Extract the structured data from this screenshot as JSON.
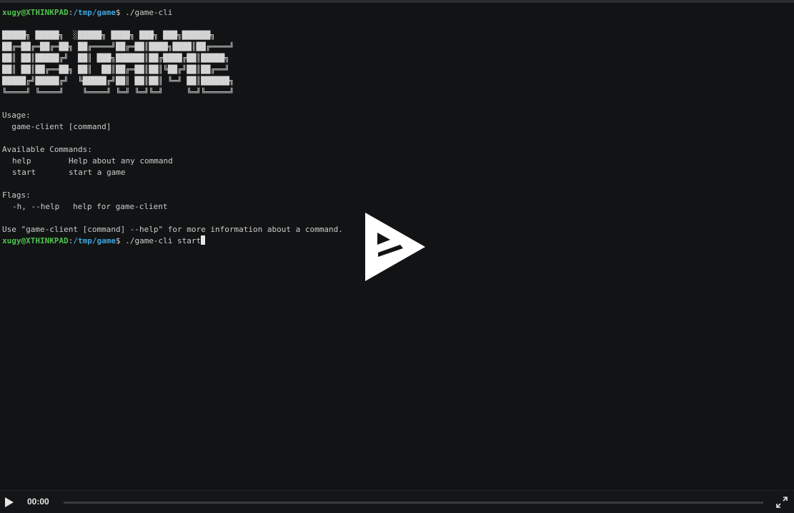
{
  "terminal": {
    "prompt_user": "xugy@XTHINKPAD",
    "prompt_sep": ":",
    "prompt_path": "/tmp/game",
    "prompt_dollar": "$",
    "command1": " ./game-cli",
    "logo_art": "█████╗ █████╗  ░█████╗ ████╗ ███╗ ███╗██████╗\n██╔═██╔═██╔═██╗ ██╔════╝██╔═██║████╗████║██╔════╝\n██║ ██║█████╔╝  ██║ ███╗██████║██╔████╔██║█████╗\n██║ ██║██╔══██╗ ██║  ██║██╔═██║██║╚██╔╝██║██╔══╝\n█████╔╝█████╔╝  ╚█████╔╝██║ ██║██║ ╚═╝ ██║██████╗\n╚════╝ ╚════╝    ╚════╝ ╚═╝ ╚═╝╚═╝     ╚═╝╚═════╝",
    "usage_heading": "Usage:",
    "usage_line": "  game-client [command]",
    "available_heading": "Available Commands:",
    "commands": [
      {
        "name": "help",
        "desc": "Help about any command"
      },
      {
        "name": "start",
        "desc": "start a game"
      }
    ],
    "flags_heading": "Flags:",
    "flag_name": "-h, --help",
    "flag_desc": "help for game-client",
    "footer_line": "Use \"game-client [command] --help\" for more information about a command.",
    "command2": " ./game-cli start"
  },
  "controls": {
    "time": "00:00",
    "progress": 0,
    "play_icon": "play-icon",
    "fullscreen_icon": "fullscreen-icon"
  },
  "colors": {
    "background": "#121314",
    "prompt_user": "#4ec34e",
    "prompt_path": "#3fa3dc",
    "text": "#cccccc"
  }
}
